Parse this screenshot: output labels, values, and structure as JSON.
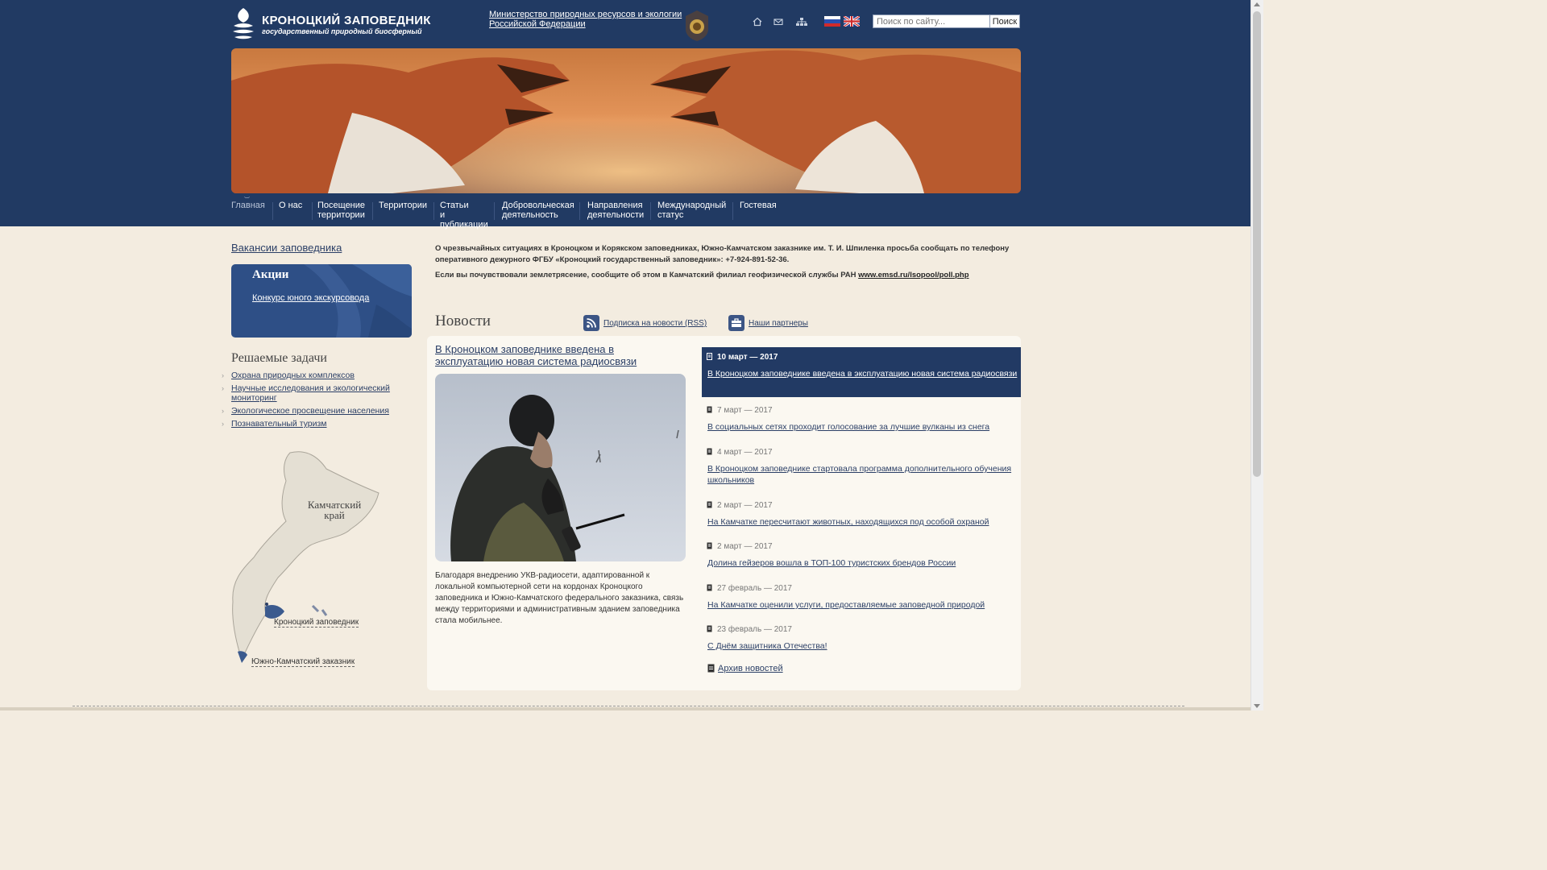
{
  "header": {
    "logo_title": "КРОНОЦКИЙ ЗАПОВЕДНИК",
    "logo_subtitle": "государственный природный биосферный",
    "ministry_line1": "Министерство природных ресурсов и экологии",
    "ministry_line2": "Российской Федерации",
    "icons": [
      "home-icon",
      "mail-icon",
      "sitemap-icon"
    ],
    "languages": [
      "ru-flag-icon",
      "en-flag-icon"
    ],
    "search_placeholder": "Поиск по сайту...",
    "search_button": "Поиск"
  },
  "nav": {
    "items": [
      {
        "l1": "Главная",
        "l2": "",
        "l3": ""
      },
      {
        "l1": "О нас",
        "l2": "",
        "l3": ""
      },
      {
        "l1": "Посещение",
        "l2": "территории",
        "l3": ""
      },
      {
        "l1": "Территории",
        "l2": "",
        "l3": ""
      },
      {
        "l1": "Статьи",
        "l2": "и",
        "l3": "публикации"
      },
      {
        "l1": "Добровольческая",
        "l2": "деятельность",
        "l3": ""
      },
      {
        "l1": "Направления",
        "l2": "деятельности",
        "l3": ""
      },
      {
        "l1": "Международный",
        "l2": "статус",
        "l3": ""
      },
      {
        "l1": "Гостевая",
        "l2": "",
        "l3": ""
      }
    ]
  },
  "sidebar": {
    "vacancies": "Вакансии заповедника",
    "actions_title": "Акции",
    "actions_link": "Конкурс юного экскурсовода",
    "tasks_title": "Решаемые задачи",
    "tasks": [
      "Охрана природных комплексов",
      "Научные исследования и экологический мониторинг",
      "Экологическое просвещение населения",
      "Познавательный туризм"
    ],
    "map_region": "Камчатский край",
    "map_region_l1": "Камчатский",
    "map_region_l2": "край",
    "map_kronotsky": "Кроноцкий заповедник",
    "map_south": "Южно-Камчатский заказник"
  },
  "main": {
    "emergency_text": "О чрезвычайных ситуациях в Кроноцком и Корякском заповедниках, Южно-Камчатском заказнике им. Т. И. Шпиленка просьба сообщать по телефону оперативного дежурного ФГБУ «Кроноцкий государственный заповедник»: +7-924-891-52-36.",
    "earthquake_text": "Если вы почувствовали землетрясение, сообщите об этом в Камчатский филиал геофизической службы РАН",
    "earthquake_link": "www.emsd.ru/lsopool/poll.php",
    "news_title": "Новости",
    "rss_link": "Подписка на новости (RSS)",
    "partners_link": "Наши партнеры",
    "feature_title": "В Кроноцком заповеднике введена в эксплуатацию новая система радиосвязи",
    "feature_text": "Благодаря внедрению УКВ-радиосети, адаптированной к локальной компьютерной сети на кордонах Кроноцкого заповедника и Южно-Камчатского федерального заказника, связь между территориями и административным зданием заповедника стала мобильнее.",
    "news": [
      {
        "date": "10 март — 2017",
        "title": "В Кроноцком заповеднике введена в эксплуатацию новая система радиосвязи"
      },
      {
        "date": "7 март — 2017",
        "title": "В социальных сетях проходит голосование за лучшие вулканы из снега"
      },
      {
        "date": "4 март — 2017",
        "title": "В Кроноцком заповеднике стартовала программа дополнительного обучения школьников"
      },
      {
        "date": "2 март — 2017",
        "title": "На Камчатке пересчитают животных, находящихся под особой охраной"
      },
      {
        "date": "2 март — 2017",
        "title": "Долина гейзеров вошла в ТОП-100 туристских брендов России"
      },
      {
        "date": "27 февраль — 2017",
        "title": "На Камчатке оценили услуги, предоставляемые заповедной природой"
      },
      {
        "date": "23 февраль — 2017",
        "title": "С Днём защитника Отечества!"
      }
    ],
    "archive_link": "Архив новостей"
  },
  "colors": {
    "header_bg": "#213a63",
    "page_bg": "#f3ece0",
    "link": "#2b3f66",
    "highlight": "#223a64"
  }
}
